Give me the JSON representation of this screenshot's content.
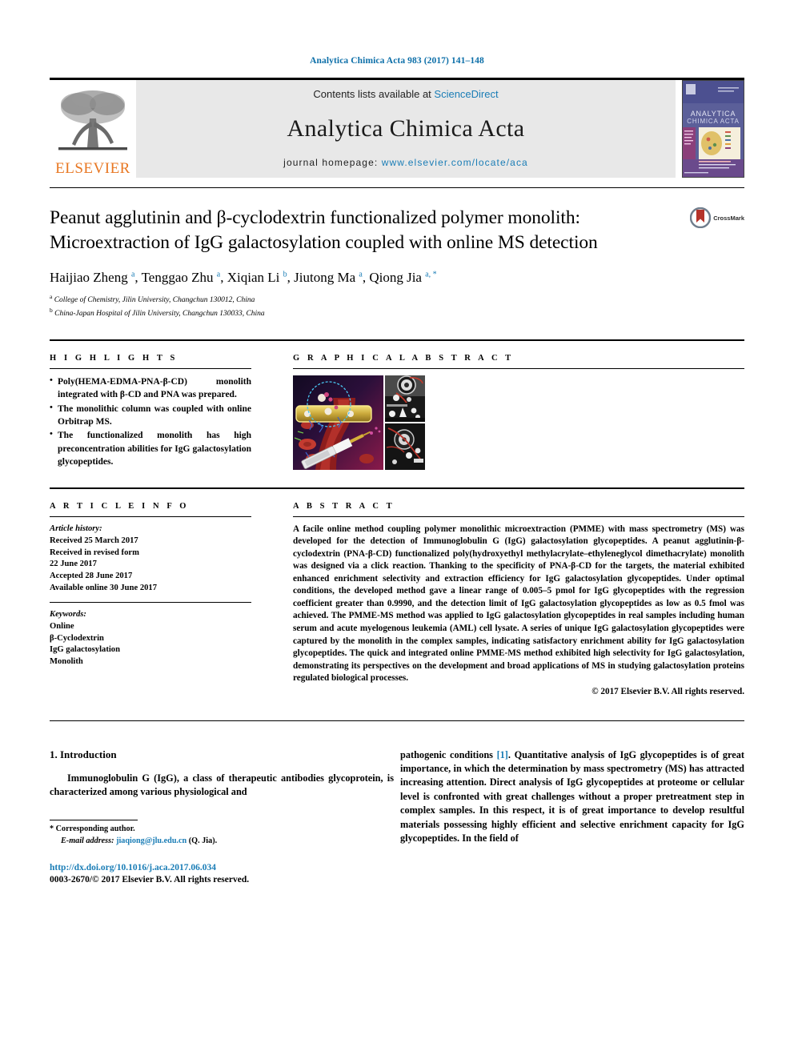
{
  "running_head": "Analytica Chimica Acta 983 (2017) 141–148",
  "masthead": {
    "publisher_wordmark": "ELSEVIER",
    "contents_prefix": "Contents lists available at ",
    "contents_link": "ScienceDirect",
    "journal_title": "Analytica Chimica Acta",
    "homepage_prefix": "journal homepage: ",
    "homepage_url": "www.elsevier.com/locate/aca",
    "cover_journal_name": "ANALYTICA CHIMICA ACTA"
  },
  "article": {
    "title": "Peanut agglutinin and β-cyclodextrin functionalized polymer monolith: Microextraction of IgG galactosylation coupled with online MS detection",
    "crossmark_label": "CrossMark",
    "authors_html": "Haijiao Zheng <sup>a</sup>, Tenggao Zhu <sup>a</sup>, Xiqian Li <sup>b</sup>, Jiutong Ma <sup>a</sup>, Qiong Jia <sup>a, *</sup>",
    "affiliations": [
      {
        "marker": "a",
        "text": "College of Chemistry, Jilin University, Changchun 130012, China"
      },
      {
        "marker": "b",
        "text": "China-Japan Hospital of Jilin University, Changchun 130033, China"
      }
    ]
  },
  "highlights": {
    "heading": "H I G H L I G H T S",
    "items": [
      "Poly(HEMA-EDMA-PNA-β-CD) monolith integrated with β-CD and PNA was prepared.",
      "The monolithic column was coupled with online Orbitrap MS.",
      "The functionalized monolith has high preconcentration abilities for IgG galactosylation glycopeptides."
    ]
  },
  "graphical_abstract": {
    "heading": "G R A P H I C A L   A B S T R A C T",
    "images": [
      {
        "name": "blood-vessel-monolith-illustration"
      },
      {
        "name": "instrument-photo-top"
      },
      {
        "name": "instrument-photo-bottom"
      }
    ]
  },
  "article_info": {
    "heading": "A R T I C L E   I N F O",
    "history_label": "Article history:",
    "history": [
      "Received 25 March 2017",
      "Received in revised form",
      "22 June 2017",
      "Accepted 28 June 2017",
      "Available online 30 June 2017"
    ],
    "keywords_label": "Keywords:",
    "keywords": [
      "Online",
      "β-Cyclodextrin",
      "IgG galactosylation",
      "Monolith"
    ]
  },
  "abstract": {
    "heading": "A B S T R A C T",
    "text": "A facile online method coupling polymer monolithic microextraction (PMME) with mass spectrometry (MS) was developed for the detection of Immunoglobulin G (IgG) galactosylation glycopeptides. A peanut agglutinin-β-cyclodextrin (PNA-β-CD) functionalized poly(hydroxyethyl methylacrylate–ethyleneglycol dimethacrylate) monolith was designed via a click reaction. Thanking to the specificity of PNA-β-CD for the targets, the material exhibited enhanced enrichment selectivity and extraction efficiency for IgG galactosylation glycopeptides. Under optimal conditions, the developed method gave a linear range of 0.005–5 pmol for IgG glycopeptides with the regression coefficient greater than 0.9990, and the detection limit of IgG galactosylation glycopeptides as low as 0.5 fmol was achieved. The PMME-MS method was applied to IgG galactosylation glycopeptides in real samples including human serum and acute myelogenous leukemia (AML) cell lysate. A series of unique IgG galactosylation glycopeptides were captured by the monolith in the complex samples, indicating satisfactory enrichment ability for IgG galactosylation glycopeptides. The quick and integrated online PMME-MS method exhibited high selectivity for IgG galactosylation, demonstrating its perspectives on the development and broad applications of MS in studying galactosylation proteins regulated biological processes.",
    "copyright": "© 2017 Elsevier B.V. All rights reserved."
  },
  "introduction": {
    "heading": "1. Introduction",
    "paragraph_col1": "Immunoglobulin G (IgG), a class of therapeutic antibodies glycoprotein, is characterized among various physiological and",
    "paragraph_col2_before_ref": "pathogenic conditions ",
    "paragraph_col2_ref": "[1]",
    "paragraph_col2_after_ref": ". Quantitative analysis of IgG glycopeptides is of great importance, in which the determination by mass spectrometry (MS) has attracted increasing attention. Direct analysis of IgG glycopeptides at proteome or cellular level is confronted with great challenges without a proper pretreatment step in complex samples. In this respect, it is of great importance to develop resultful materials possessing highly efficient and selective enrichment capacity for IgG glycopeptides. In the field of"
  },
  "footer": {
    "corresponding_marker": "*",
    "corresponding_label": "Corresponding author.",
    "email_label": "E-mail address:",
    "email": "jiaqiong@jlu.edu.cn",
    "email_suffix": "(Q. Jia).",
    "doi": "http://dx.doi.org/10.1016/j.aca.2017.06.034",
    "issn_line": "0003-2670/© 2017 Elsevier B.V. All rights reserved."
  },
  "colors": {
    "link": "#1a7db6",
    "elsevier_orange": "#e87722",
    "masthead_grey": "#e8e8e8"
  }
}
